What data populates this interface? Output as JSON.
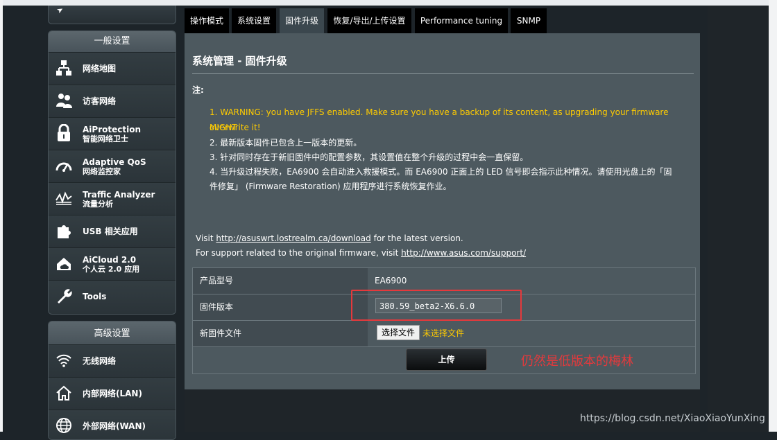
{
  "sidebar": {
    "general_title": "一般设置",
    "items": [
      {
        "label": "网络地图",
        "sub": "",
        "icon": "network-map-icon"
      },
      {
        "label": "访客网络",
        "sub": "",
        "icon": "guest-network-icon"
      },
      {
        "label": "AiProtection",
        "sub": "智能网络卫士",
        "icon": "lock-icon"
      },
      {
        "label": "Adaptive QoS",
        "sub": "网络监控家",
        "icon": "gauge-icon"
      },
      {
        "label": "Traffic Analyzer",
        "sub": "流量分析",
        "icon": "chart-wave-icon"
      },
      {
        "label": "USB 相关应用",
        "sub": "",
        "icon": "puzzle-icon"
      },
      {
        "label": "AiCloud 2.0",
        "sub": "个人云 2.0 应用",
        "icon": "cloud-home-icon"
      },
      {
        "label": "Tools",
        "sub": "",
        "icon": "wrench-icon"
      }
    ],
    "advanced_title": "高级设置",
    "advanced_items": [
      {
        "label": "无线网络",
        "icon": "wifi-icon"
      },
      {
        "label": "内部网络(LAN)",
        "icon": "home-icon"
      },
      {
        "label": "外部网络(WAN)",
        "icon": "globe-icon"
      }
    ]
  },
  "tabs": [
    "操作模式",
    "系统设置",
    "固件升级",
    "恢复/导出/上传设置",
    "Performance tuning",
    "SNMP"
  ],
  "active_tab": "固件升级",
  "page": {
    "title": "系统管理 - 固件升级",
    "note_label": "注:",
    "notes": [
      "1. WARNING: you have JFFS enabled. Make sure you have a backup of its content, as upgrading your firmware MIGHT",
      "overwrite it!",
      "2. 最新版本固件已包含上一版本的更新。",
      "3. 针对同时存在于新旧固件中的配置参数，其设置值在整个升级的过程中会一直保留。",
      "4. 当升级过程失败，EA6900 会自动进入救援模式。而 EA6900 正面上的 LED 信号即会指示此种情况。请使用光盘上的「固",
      "件修复」 (Firmware Restoration) 应用程序进行系统恢复作业。"
    ],
    "visit_prefix": "Visit ",
    "visit_link": "http://asuswrt.lostrealm.ca/download",
    "visit_suffix": " for the latest version.",
    "support_prefix": "For support related to the original firmware, visit ",
    "support_link": "http://www.asus.com/support/",
    "rows": {
      "model_label": "产品型号",
      "model_value": "EA6900",
      "version_label": "固件版本",
      "version_value": "380.59_beta2-X6.6.0",
      "file_label": "新固件文件",
      "choose_file": "选择文件",
      "no_file": "未选择文件"
    },
    "upload": "上传"
  },
  "annotation": "仍然是低版本的梅林",
  "watermark": "https://blog.csdn.net/XiaoXiaoYunXing",
  "colors": {
    "warning": "#ffcc00",
    "annotation": "#e5393c",
    "panel": "#4d595f"
  }
}
